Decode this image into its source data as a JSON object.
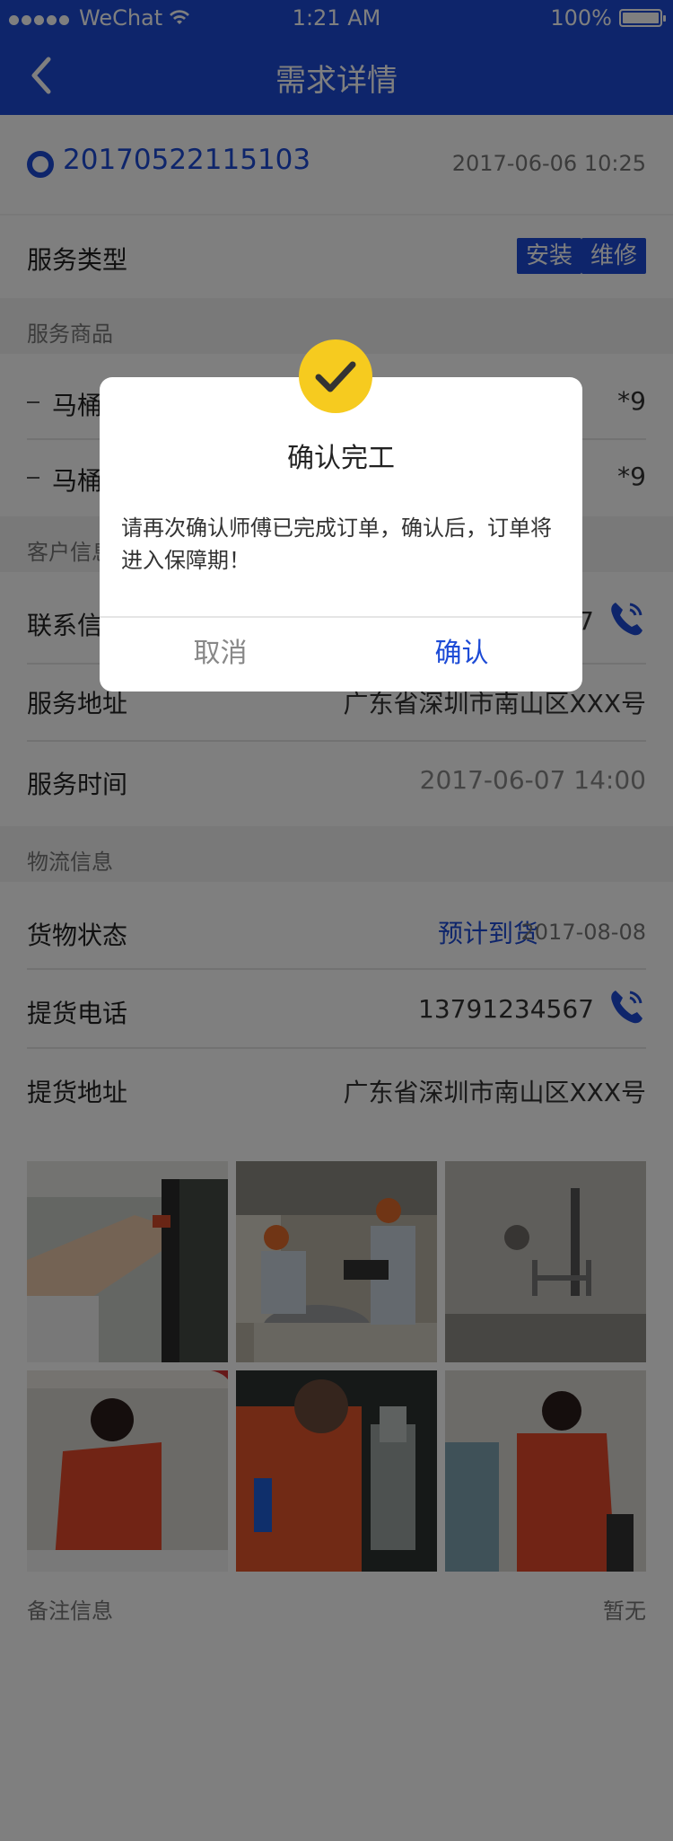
{
  "status_bar": {
    "carrier": "WeChat",
    "time": "1:21 AM",
    "battery": "100%"
  },
  "nav": {
    "title": "需求详情"
  },
  "order": {
    "number": "20170522115103",
    "datetime": "2017-06-06 10:25"
  },
  "service_type": {
    "label": "服务类型",
    "tags": [
      "安装",
      "维修"
    ]
  },
  "service_goods": {
    "section_title": "服务商品",
    "items": [
      {
        "name": "马桶",
        "qty": "*9"
      },
      {
        "name": "马桶",
        "qty": "*9"
      }
    ]
  },
  "customer": {
    "section_title": "客户信息",
    "contact_label": "联系信",
    "contact_value_tail": "7",
    "address_label": "服务地址",
    "address_value": "广东省深圳市南山区XXX号",
    "time_label": "服务时间",
    "time_value": "2017-06-07    14:00"
  },
  "logistics": {
    "section_title": "物流信息",
    "status_label": "货物状态",
    "status_value": "预计到货",
    "status_date": "2017-08-08",
    "phone_label": "提货电话",
    "phone_value": "13791234567",
    "address_label": "提货地址",
    "address_value": "广东省深圳市南山区XXX号"
  },
  "photos": [
    "photo-1",
    "photo-2",
    "photo-3",
    "photo-4",
    "photo-5",
    "photo-6"
  ],
  "remarks": {
    "label": "备注信息",
    "value": "暂无"
  },
  "modal": {
    "title": "确认完工",
    "body": "请再次确认师傅已完成订单，确认后，订单将进入保障期！",
    "cancel": "取消",
    "confirm": "确认"
  },
  "colors": {
    "primary": "#1d4bd6",
    "check": "#f6cb1f"
  }
}
